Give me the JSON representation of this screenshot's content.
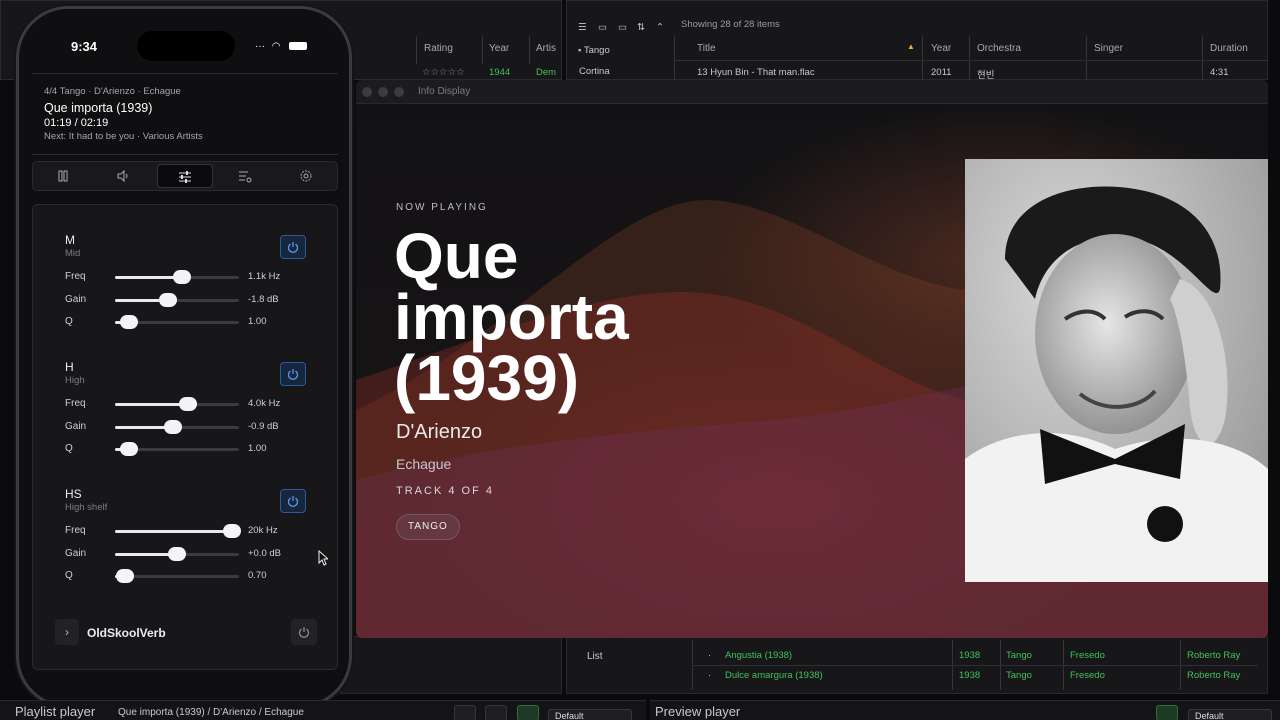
{
  "library": {
    "left_columns": [
      "Rating",
      "Year",
      "Artis"
    ],
    "left_row": {
      "year": "1944",
      "artist": "Dem"
    },
    "showing": "Showing 28 of 28 items",
    "folders": [
      "Tango",
      "Cortina"
    ],
    "columns": [
      "Title",
      "Year",
      "Orchestra",
      "Singer",
      "Duration"
    ],
    "top_row": {
      "title": "13 Hyun Bin - That man.flac",
      "year": "2011",
      "orchestra": "현빈",
      "singer": "",
      "duration": "4:31"
    },
    "list_label": "List",
    "rows": [
      {
        "title": "Angustia (1938)",
        "year": "1938",
        "genre": "Tango",
        "orchestra": "Fresedo",
        "singer": "Roberto Ray"
      },
      {
        "title": "Dulce amargura (1938)",
        "year": "1938",
        "genre": "Tango",
        "orchestra": "Fresedo",
        "singer": "Roberto Ray"
      }
    ]
  },
  "info_display": {
    "window_title": "Info Display",
    "now_playing_label": "NOW PLAYING",
    "title": "Que importa (1939)",
    "artist": "D'Arienzo",
    "singer": "Echague",
    "track": "TRACK 4 OF 4",
    "genre_chip": "TANGO"
  },
  "phone": {
    "status_time": "9:34",
    "now": {
      "meta": "4/4 Tango · D'Arienzo · Echague",
      "title": "Que importa (1939)",
      "time": "01:19 / 02:19",
      "next": "Next: It had to be you · Various Artists"
    },
    "tabs": [
      "pause-icon",
      "volume-icon",
      "equalizer-icon",
      "playlist-icon",
      "settings-icon"
    ],
    "bands": [
      {
        "name": "M",
        "sub": "Mid",
        "freq": "1.1k Hz",
        "gain": "-1.8 dB",
        "q": "1.00",
        "freq_pos": 0.54,
        "gain_pos": 0.43,
        "q_pos": 0.11
      },
      {
        "name": "H",
        "sub": "High",
        "freq": "4.0k Hz",
        "gain": "-0.9 dB",
        "q": "1.00",
        "freq_pos": 0.59,
        "gain_pos": 0.47,
        "q_pos": 0.11
      },
      {
        "name": "HS",
        "sub": "High shelf",
        "freq": "20k Hz",
        "gain": "+0.0 dB",
        "q": "0.70",
        "freq_pos": 0.94,
        "gain_pos": 0.5,
        "q_pos": 0.08
      }
    ],
    "param_labels": {
      "freq": "Freq",
      "gain": "Gain",
      "q": "Q"
    },
    "reverb": "OldSkoolVerb"
  },
  "bottom": {
    "playlist_title": "Playlist player",
    "crumbs": "Que importa (1939)  /  D'Arienzo  /  Echague",
    "select_value": "Default",
    "preview_title": "Preview player",
    "preview_select": "Default"
  },
  "colors": {
    "accent_green": "#41c15a",
    "accent_blue": "#2e5a96"
  }
}
